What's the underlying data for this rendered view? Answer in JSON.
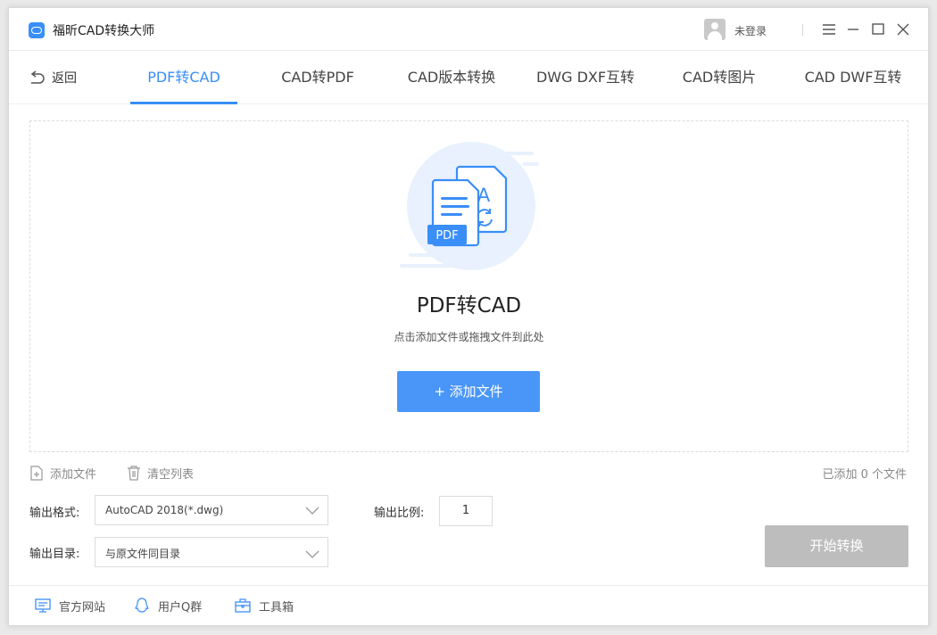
{
  "app": {
    "title": "福昕CAD转换大师",
    "login_text": "未登录"
  },
  "nav": {
    "back_label": "返回",
    "tabs": [
      {
        "label": "PDF转CAD"
      },
      {
        "label": "CAD转PDF"
      },
      {
        "label": "CAD版本转换"
      },
      {
        "label": "DWG DXF互转"
      },
      {
        "label": "CAD转图片"
      },
      {
        "label": "CAD DWF互转"
      }
    ],
    "active_tab": "PDF转CAD"
  },
  "dropzone": {
    "title": "PDF转CAD",
    "hint": "点击添加文件或拖拽文件到此处",
    "add_button": "+ 添加文件",
    "pdf_badge": "PDF",
    "cad_letter": "A"
  },
  "toolbar": {
    "add_file": "添加文件",
    "clear_list": "清空列表",
    "count_text": "已添加 0 个文件"
  },
  "settings": {
    "format_label": "输出格式:",
    "format_value": "AutoCAD 2018(*.dwg)",
    "dir_label": "输出目录:",
    "dir_value": "与原文件同目录",
    "ratio_label": "输出比例:",
    "ratio_value": "1"
  },
  "start_button": "开始转换",
  "footer": {
    "website": "官方网站",
    "qq_group": "用户Q群",
    "toolbox": "工具箱"
  },
  "colors": {
    "accent": "#3a8ef7",
    "disabled": "#bdbdbd"
  }
}
